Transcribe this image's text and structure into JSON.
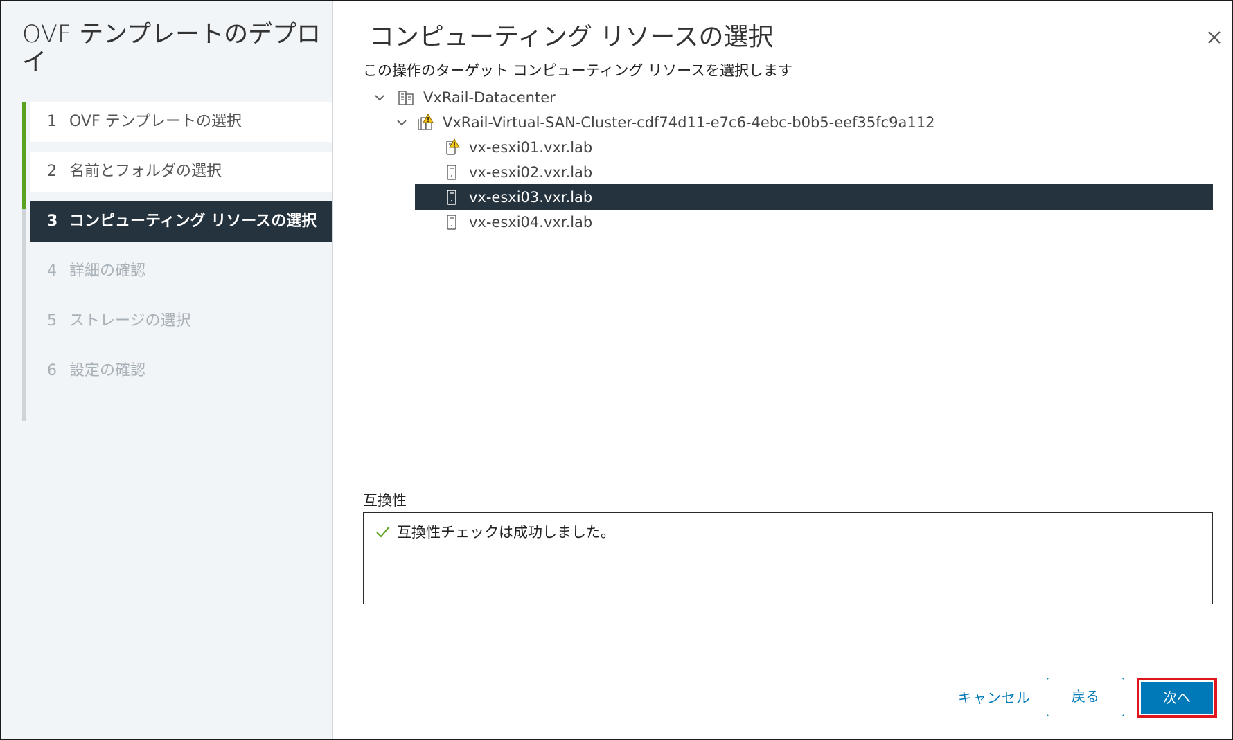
{
  "dialog": {
    "title": "OVF テンプレートのデプロイ",
    "steps": [
      {
        "num": "1",
        "label": "OVF テンプレートの選択",
        "state": "done"
      },
      {
        "num": "2",
        "label": "名前とフォルダの選択",
        "state": "done"
      },
      {
        "num": "3",
        "label": "コンピューティング リソースの選択",
        "state": "active"
      },
      {
        "num": "4",
        "label": "詳細の確認",
        "state": "future"
      },
      {
        "num": "5",
        "label": "ストレージの選択",
        "state": "future"
      },
      {
        "num": "6",
        "label": "設定の確認",
        "state": "future"
      }
    ]
  },
  "main": {
    "heading": "コンピューティング リソースの選択",
    "subtitle": "この操作のターゲット コンピューティング リソースを選択します",
    "tree": {
      "datacenter": {
        "label": "VxRail-Datacenter",
        "icon": "datacenter-icon",
        "expanded": true
      },
      "cluster": {
        "label": "VxRail-Virtual-SAN-Cluster-cdf74d11-e7c6-4ebc-b0b5-eef35fc9a112",
        "icon": "cluster-warning-icon",
        "expanded": true
      },
      "hosts": [
        {
          "label": "vx-esxi01.vxr.lab",
          "icon": "host-warning-icon",
          "selected": false
        },
        {
          "label": "vx-esxi02.vxr.lab",
          "icon": "host-icon",
          "selected": false
        },
        {
          "label": "vx-esxi03.vxr.lab",
          "icon": "host-icon",
          "selected": true
        },
        {
          "label": "vx-esxi04.vxr.lab",
          "icon": "host-icon",
          "selected": false
        }
      ]
    },
    "compatibility": {
      "label": "互換性",
      "message": "互換性チェックは成功しました。"
    }
  },
  "footer": {
    "cancel": "キャンセル",
    "back": "戻る",
    "next": "次へ"
  },
  "colors": {
    "accent": "#0079b8",
    "selected_bg": "#25333e",
    "done_rail": "#5aa220",
    "highlight": "#e0161f"
  }
}
